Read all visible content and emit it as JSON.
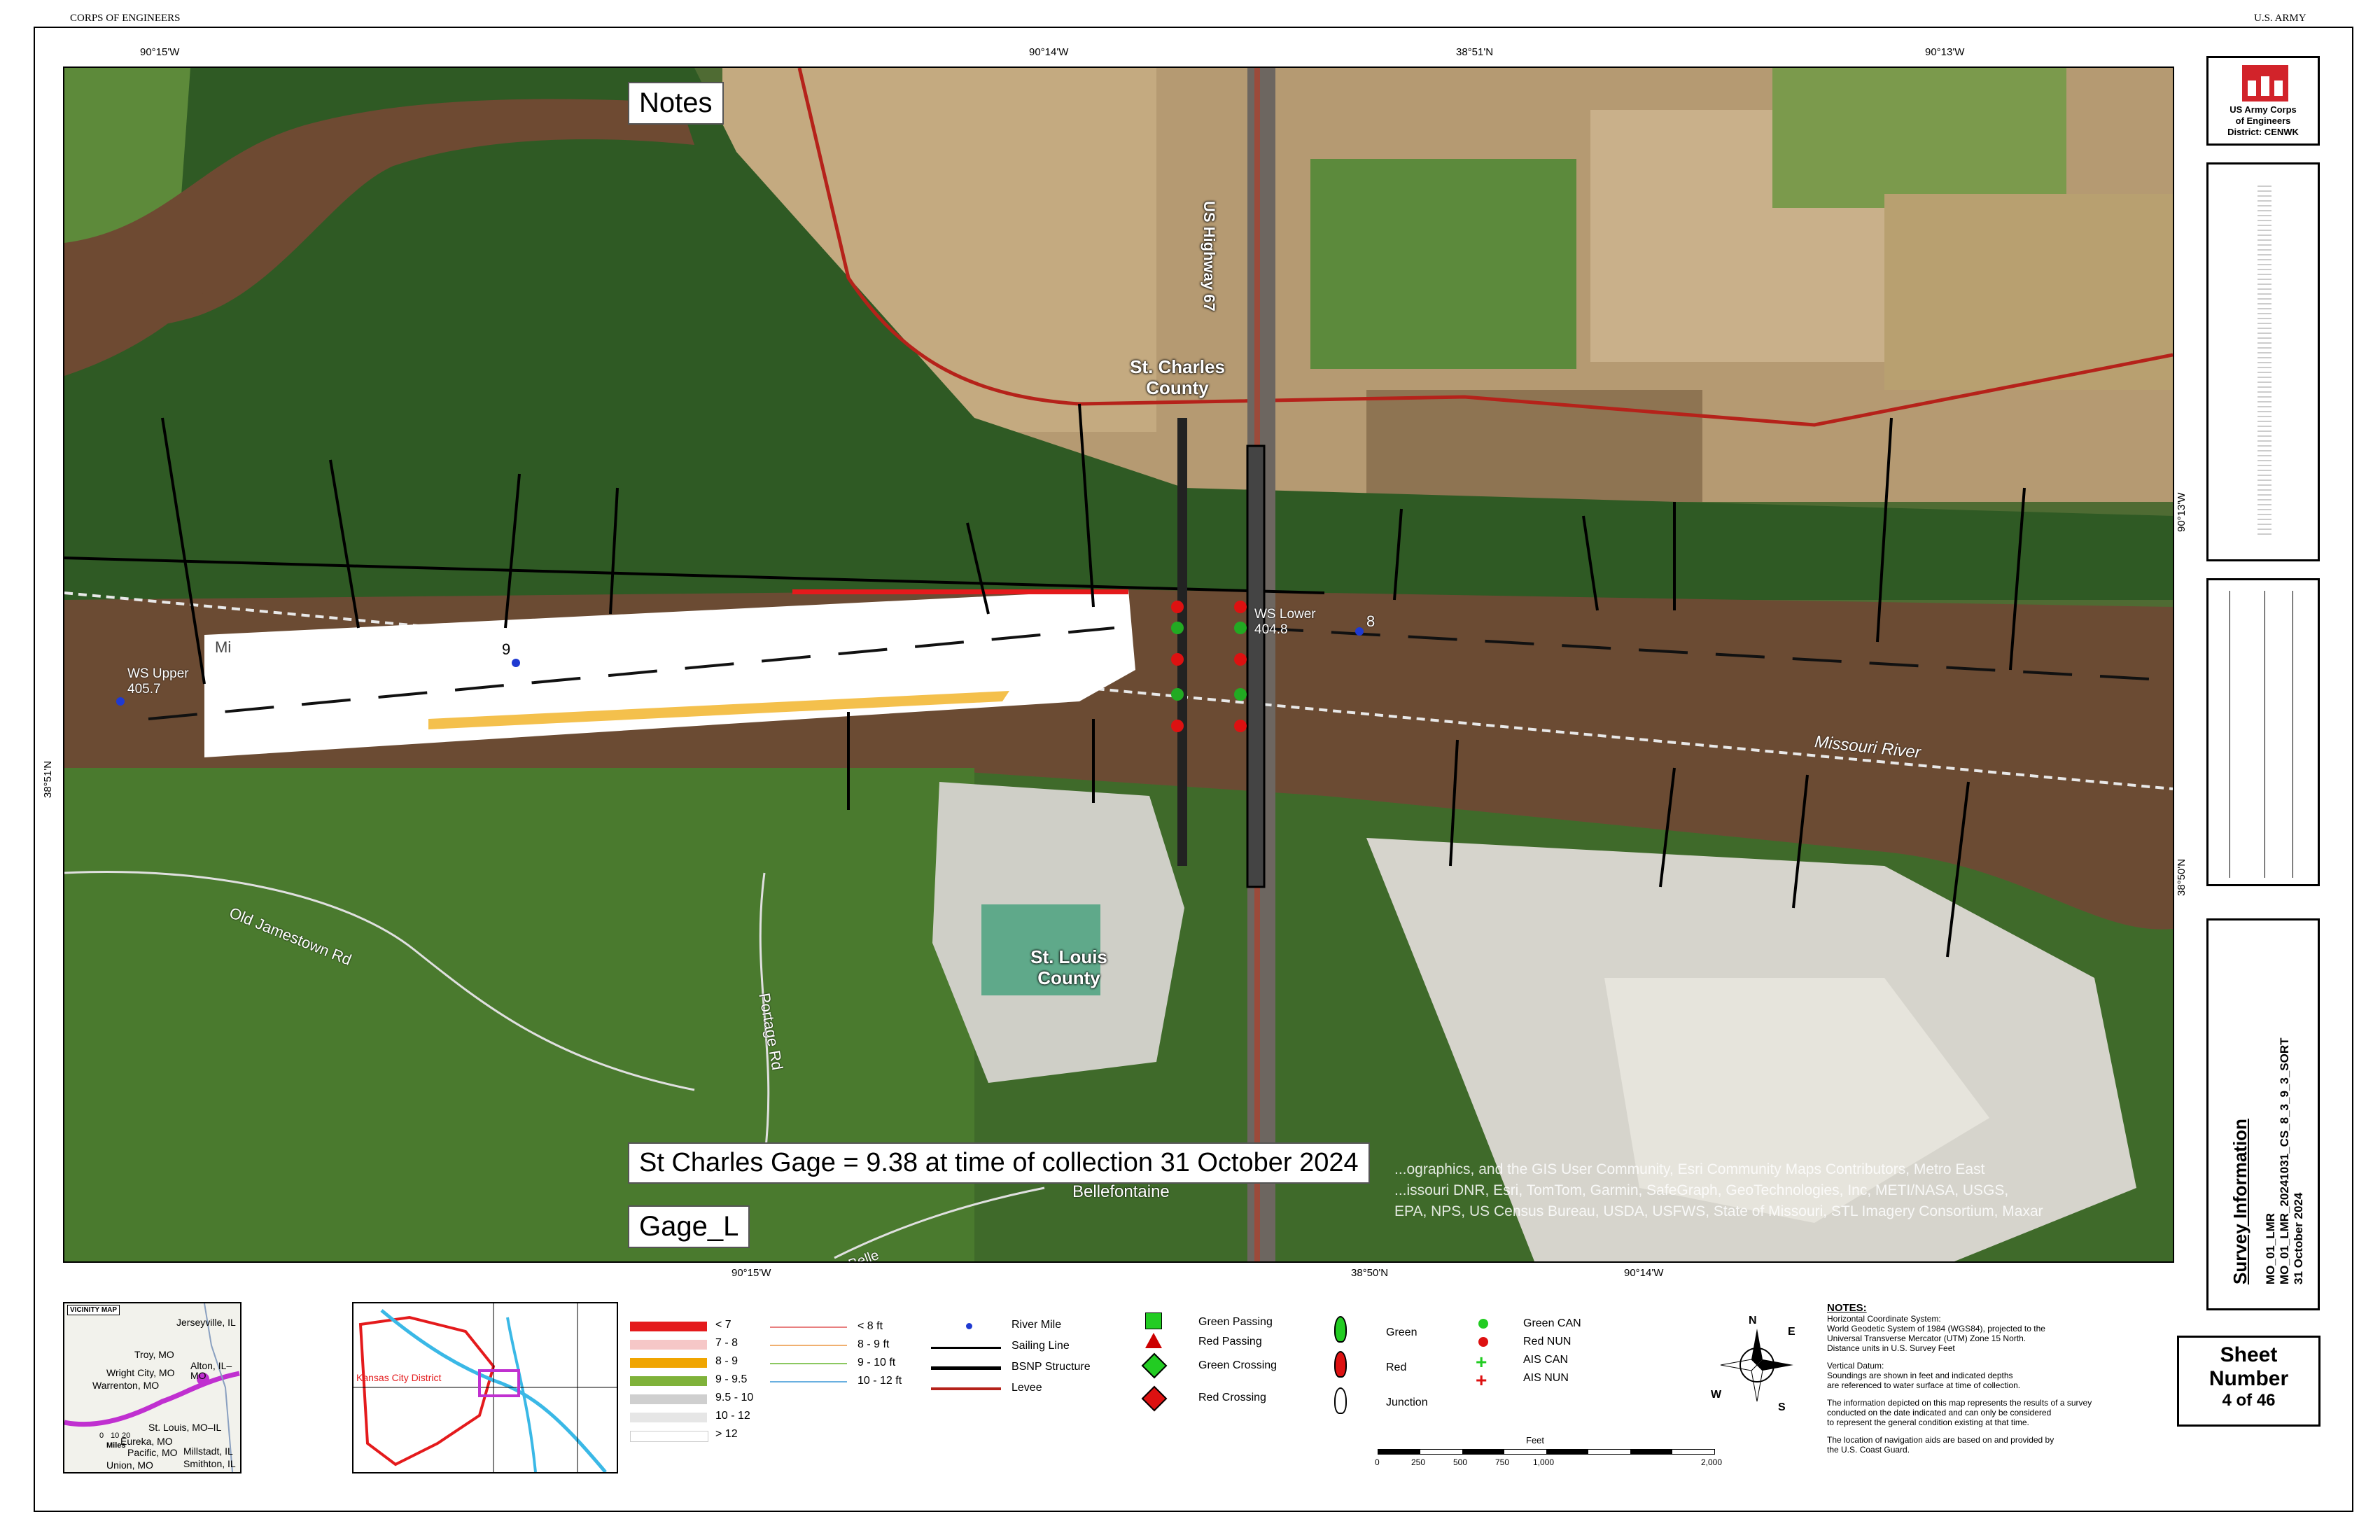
{
  "header": {
    "left": "CORPS OF ENGINEERS",
    "right": "U.S. ARMY"
  },
  "logo": {
    "line1": "US Army Corps",
    "line2": "of Engineers",
    "line3": "District: CENWK"
  },
  "coords": {
    "top": [
      "90°15'W",
      "90°14'W",
      "38°51'N",
      "90°13'W"
    ],
    "bottom": [
      "90°15'W",
      "38°50'N",
      "90°14'W"
    ],
    "left": [
      "38°51'N"
    ],
    "right": [
      "90°13'W",
      "38°50'N"
    ]
  },
  "map": {
    "notes_box": "Notes",
    "gage_text": "St Charles Gage = 9.38 at time of collection 31 October 2024",
    "gage_box": "Gage_L",
    "labels": {
      "st_charles": "St. Charles\nCounty",
      "st_louis": "St. Louis\nCounty",
      "highway": "US Highway 67",
      "river": "Missouri River",
      "old_jamestown": "Old Jamestown Rd",
      "portage": "Portage Rd",
      "bellefontaine": "Bellefontaine",
      "ferry": "Fort Belle",
      "ws_upper": "WS Upper",
      "ws_upper_val": "405.7",
      "ws_lower": "WS Lower",
      "ws_lower_val": "404.8",
      "mile9": "9",
      "mile8": "8",
      "short_mi": "Mi"
    },
    "attribution": [
      "...ographics, and the GIS User Community, Esri Community Maps Contributors, Metro East",
      "...issouri DNR, Esri, TomTom, Garmin, SafeGraph, GeoTechnologies, Inc, METI/NASA, USGS,",
      "EPA, NPS, US Census Bureau, USDA, USFWS, State of Missouri, STL Imagery Consortium, Maxar"
    ]
  },
  "vicinity": {
    "title": "VICINITY MAP",
    "places": [
      "Jerseyville, IL",
      "Troy, MO",
      "Wright City, MO",
      "Warrenton, MO",
      "Alton, IL–MO",
      "St. Louis, MO–IL",
      "Eureka, MO",
      "Pacific, MO",
      "Union, MO",
      "Millstadt, IL",
      "Smithton, IL"
    ],
    "scale": [
      "0",
      "10",
      "20"
    ],
    "scale_unit": "Miles"
  },
  "district_map": {
    "label": "Kansas City District"
  },
  "legend": {
    "depths": [
      {
        "label": "< 7",
        "color": "#e41a1c"
      },
      {
        "label": "7 - 8",
        "color": "#f6c7c7"
      },
      {
        "label": "8 - 9",
        "color": "#f0a500"
      },
      {
        "label": "9 - 9.5",
        "color": "#7fb23a"
      },
      {
        "label": "9.5 - 10",
        "color": "#cfcfcf"
      },
      {
        "label": "10 - 12",
        "color": "#e6e6e6"
      },
      {
        "label": "> 12",
        "color": "#ffffff"
      }
    ],
    "contours": [
      {
        "label": "< 8 ft",
        "color": "#e88080"
      },
      {
        "label": "8 - 9 ft",
        "color": "#f0b070"
      },
      {
        "label": "9 - 10 ft",
        "color": "#8cc860"
      },
      {
        "label": "10 - 12 ft",
        "color": "#6ab0e0"
      }
    ],
    "lines": [
      {
        "label": "River Mile"
      },
      {
        "label": "Sailing Line"
      },
      {
        "label": "BSNP Structure"
      },
      {
        "label": "Levee"
      }
    ],
    "nav": [
      "Green Passing",
      "Red Passing",
      "Green Crossing",
      "Red Crossing"
    ],
    "buoys": [
      "Green",
      "Red",
      "Junction"
    ],
    "cans": [
      "Green CAN",
      "Red NUN",
      "AIS CAN",
      "AIS NUN"
    ]
  },
  "compass": {
    "n": "N",
    "s": "S",
    "e": "E",
    "w": "W"
  },
  "scale_bar": {
    "unit": "Feet",
    "ticks": [
      "0",
      "250",
      "500",
      "750",
      "1,000",
      "2,000"
    ]
  },
  "notes": {
    "title": "NOTES:",
    "lines": [
      "Horizontal Coordinate System:",
      "World Geodetic System of 1984 (WGS84), projected to the",
      "Universal Transverse Mercator (UTM) Zone 15 North.",
      "Distance units in U.S. Survey Feet",
      "",
      "Vertical Datum:",
      "Soundings are shown in feet and indicated depths",
      "are referenced to water surface at time of collection.",
      "",
      "The information depicted on this map represents the results of a survey",
      "conducted on the date indicated and can only be considered",
      "to represent the general condition existing at that time.",
      "",
      "The location of navigation aids are based on and provided by",
      "the U.S. Coast Guard."
    ]
  },
  "survey": {
    "title": "Survey Information",
    "line1": "MO_01_LMR",
    "line2": "MO_01_LMR_20241031_CS_8_3_9_3_SORT",
    "date": "31 October 2024"
  },
  "sheet": {
    "label1": "Sheet",
    "label2": "Number",
    "value": "4 of 46"
  }
}
